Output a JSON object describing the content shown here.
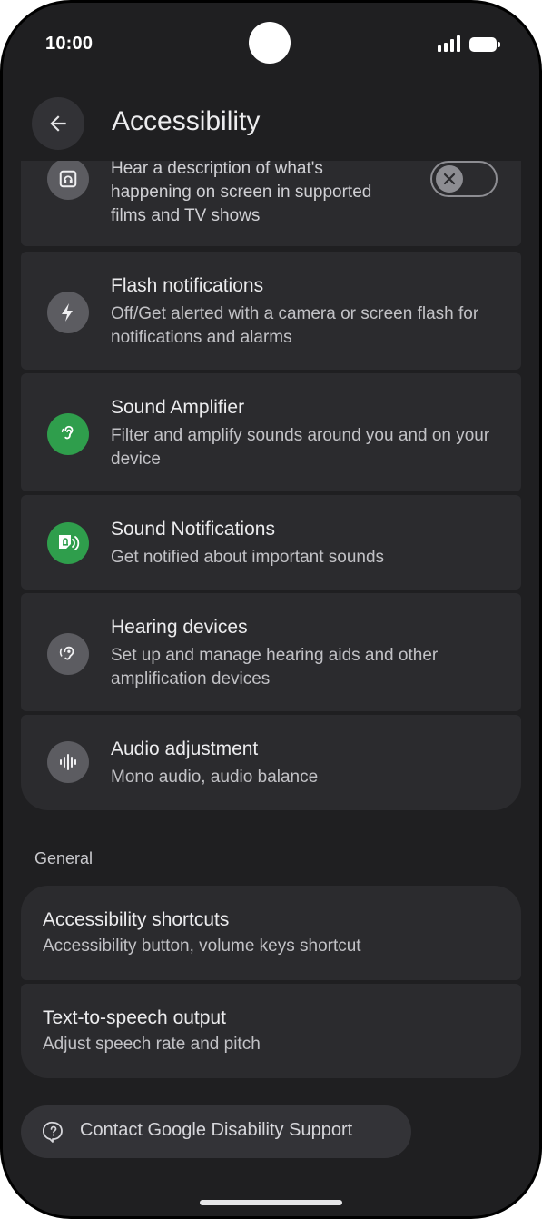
{
  "status": {
    "time": "10:00"
  },
  "header": {
    "title": "Accessibility",
    "back_icon": "arrow-left-icon"
  },
  "items": [
    {
      "icon": "audio-description-icon",
      "subtitle": "Hear a description of what's happening on screen in supported films and TV shows",
      "toggle": "off"
    },
    {
      "icon": "flash-icon",
      "title": "Flash notifications",
      "subtitle": "Off/Get alerted with a camera or screen flash for notifications and alarms"
    },
    {
      "icon": "ear-amplifier-icon",
      "title": "Sound Amplifier",
      "subtitle": "Filter and amplify sounds around you and on your device"
    },
    {
      "icon": "sound-notification-icon",
      "title": "Sound Notifications",
      "subtitle": "Get notified about important sounds"
    },
    {
      "icon": "hearing-aid-icon",
      "title": "Hearing devices",
      "subtitle": "Set up and manage hearing aids and other amplification devices"
    },
    {
      "icon": "audio-wave-icon",
      "title": "Audio adjustment",
      "subtitle": "Mono audio, audio balance"
    }
  ],
  "general": {
    "header": "General",
    "items": [
      {
        "title": "Accessibility shortcuts",
        "subtitle": "Accessibility button, volume keys shortcut"
      },
      {
        "title": "Text-to-speech output",
        "subtitle": "Adjust speech rate and pitch"
      }
    ]
  },
  "support": {
    "label": "Contact Google Disability Support",
    "icon": "help-circle-icon"
  },
  "colors": {
    "background": "#1f1f21",
    "card": "#2b2b2e",
    "accent_green": "#2f9e4c"
  }
}
